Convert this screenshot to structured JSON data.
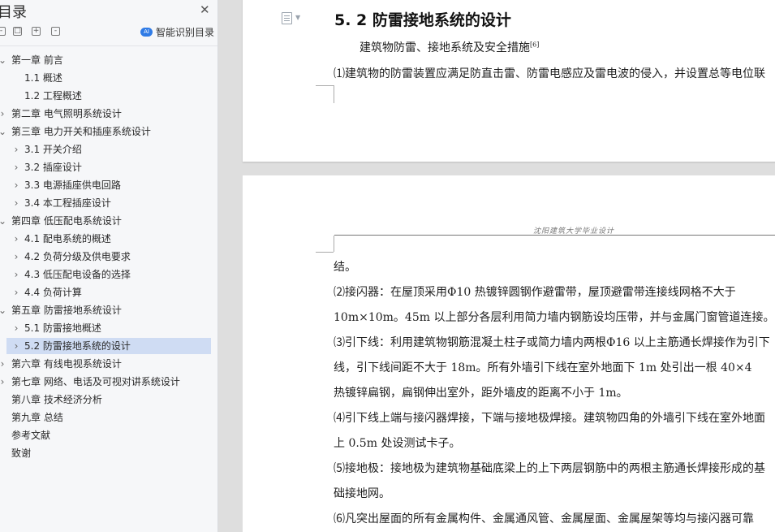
{
  "sidebar": {
    "title": "目录",
    "smart_toc": "智能识别目录",
    "items": [
      {
        "label": "第一章  前言",
        "level": 0,
        "arrow": "expanded"
      },
      {
        "label": "1.1  概述",
        "level": 1,
        "arrow": "none"
      },
      {
        "label": "1.2  工程概述",
        "level": 1,
        "arrow": "none"
      },
      {
        "label": "第二章  电气照明系统设计",
        "level": 0,
        "arrow": "collapsed"
      },
      {
        "label": "第三章  电力开关和插座系统设计",
        "level": 0,
        "arrow": "expanded"
      },
      {
        "label": "3.1  开关介绍",
        "level": 1,
        "arrow": "collapsed"
      },
      {
        "label": "3.2  插座设计",
        "level": 1,
        "arrow": "collapsed"
      },
      {
        "label": "3.3  电源插座供电回路",
        "level": 1,
        "arrow": "collapsed"
      },
      {
        "label": "3.4  本工程插座设计",
        "level": 1,
        "arrow": "collapsed"
      },
      {
        "label": "第四章  低压配电系统设计",
        "level": 0,
        "arrow": "expanded"
      },
      {
        "label": "4.1  配电系统的概述",
        "level": 1,
        "arrow": "collapsed"
      },
      {
        "label": "4.2  负荷分级及供电要求",
        "level": 1,
        "arrow": "collapsed"
      },
      {
        "label": "4.3  低压配电设备的选择",
        "level": 1,
        "arrow": "collapsed"
      },
      {
        "label": "4.4  负荷计算",
        "level": 1,
        "arrow": "collapsed"
      },
      {
        "label": "第五章  防雷接地系统设计",
        "level": 0,
        "arrow": "expanded"
      },
      {
        "label": "5.1  防雷接地概述",
        "level": 1,
        "arrow": "collapsed"
      },
      {
        "label": "5.2  防雷接地系统的设计",
        "level": 1,
        "arrow": "collapsed",
        "selected": true
      },
      {
        "label": "第六章  有线电视系统设计",
        "level": 0,
        "arrow": "collapsed"
      },
      {
        "label": "第七章  网络、电话及可视对讲系统设计",
        "level": 0,
        "arrow": "collapsed"
      },
      {
        "label": "第八章  技术经济分析",
        "level": 0,
        "arrow": "none"
      },
      {
        "label": "第九章  总结",
        "level": 0,
        "arrow": "none"
      },
      {
        "label": "参考文献",
        "level": 0,
        "arrow": "none"
      },
      {
        "label": "致谢",
        "level": 0,
        "arrow": "none"
      }
    ]
  },
  "document": {
    "heading": "5. 2  防雷接地系统的设计",
    "subheading": "建筑物防雷、接地系统及安全措施",
    "citation": "[6]",
    "page1_line": "⑴建筑物的防雷装置应满足防直击雷、防雷电感应及雷电波的侵入，并设置总等电位联",
    "page_header": "沈阳建筑大学毕业设计",
    "page2_lines": [
      "结。",
      "⑵接闪器：在屋顶采用Φ10 热镀锌圆钢作避雷带，屋顶避雷带连接线网格不大于",
      "10m×10m。45m 以上部分各层利用简力墙内钢筋设均压带，并与金属门窗管道连接。",
      "⑶引下线：利用建筑物钢筋混凝土柱子或简力墙内两根Φ16 以上主筋通长焊接作为引下",
      "线，引下线间距不大于 18m。所有外墙引下线在室外地面下 1m 处引出一根 40×4",
      "热镀锌扁钢，扁钢伸出室外，距外墙皮的距离不小于 1m。",
      "⑷引下线上端与接闪器焊接，下端与接地极焊接。建筑物四角的外墙引下线在室外地面",
      "上 0.5m 处设测试卡子。",
      "⑸接地极：接地极为建筑物基础底梁上的上下两层钢筋中的两根主筋通长焊接形成的基",
      "础接地网。",
      "⑹凡突出屋面的所有金属构件、金属通风管、金属屋面、金属屋架等均与接闪器可靠"
    ]
  }
}
